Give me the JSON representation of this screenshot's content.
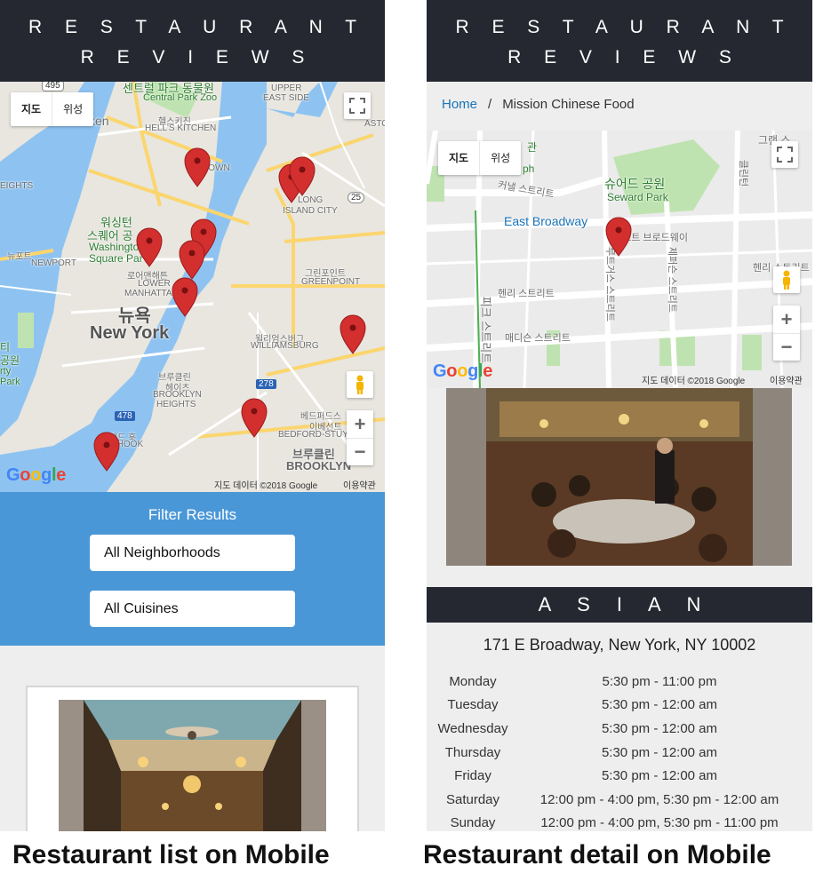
{
  "colors": {
    "header_bg": "#252831",
    "filter_bg": "#4a97d7",
    "link": "#1a73b8",
    "marker": "#d32f2f",
    "water": "#8ec3f1",
    "road": "#fbd56e"
  },
  "list_screen": {
    "header": {
      "line1": "R E S T A U R A N T",
      "line2": "R E V I E W S"
    },
    "map": {
      "map_type": {
        "map": "지도",
        "satellite": "위성"
      },
      "labels": {
        "central_park": "센트럴 파크 동물원",
        "central_park_zoo": "Central Park Zoo",
        "upper": "UPPER",
        "east_side": "EAST SIDE",
        "hells_kr": "헬스키친",
        "hells_en": "HELL'S KITCHEN",
        "ken": "ken",
        "midtown": "MIDTOWN",
        "washington_kr": "워싱턴",
        "washington_kr2": "스퀘어 공",
        "washington_en": "Washington",
        "washington_en2": "Square Par",
        "lower_kr": "로어맨해튼",
        "lower": "LOWER",
        "manhattan": "MANHATTAN",
        "newyork_kr": "뉴욕",
        "newyork_en": "New York",
        "newport_kr": "뉴포트",
        "newport_en": "NEWPORT",
        "long_island": "LONG",
        "island_city": "ISLAND CITY",
        "greenpoint_kr": "그린포인트",
        "greenpoint_en": "GREENPOINT",
        "williamsburg_kr": "윌리엄스버그",
        "williamsburg_en": "WILLIAMSBURG",
        "brooklyn_heights_kr": "브루클린",
        "brooklyn_heights_kr2": "헤이츠",
        "brooklyn_heights_en": "BROOKLYN",
        "heights": "HEIGHTS",
        "bedford_kr": "베드퍼드스",
        "bedford_kr2": "이베선트",
        "bedford_en": "BEDFORD-STUY",
        "brooklyn_kr": "브루클린",
        "brooklyn_en": "BROOKLYN",
        "red_hook_kr": "레드 훅",
        "red_hook_en": "ED HOOK",
        "heights_left": "EIGHTS",
        "route_495": "495",
        "route_25": "25",
        "route_278": "278",
        "route_478": "478",
        "astoria": "ASTO",
        "left_edge1": "티",
        "left_edge2": "공원",
        "left_edge3": "rty",
        "left_edge4": "Park"
      },
      "google": [
        "G",
        "o",
        "o",
        "g",
        "l",
        "e"
      ],
      "credit": "지도 데이터 ©2018 Google",
      "terms": "이용약관",
      "fullscreen_icon": "fullscreen-icon",
      "pegman_icon": "pegman-icon"
    },
    "filter": {
      "title": "Filter Results",
      "neighborhoods": "All Neighborhoods",
      "cuisines": "All Cuisines"
    }
  },
  "detail_screen": {
    "header": {
      "line1": "R E S T A U R A N T",
      "line2": "R E V I E W S"
    },
    "breadcrumb": {
      "home": "Home",
      "separator": "/",
      "current": "Mission Chinese Food"
    },
    "map": {
      "map_type": {
        "map": "지도",
        "satellite": "위성"
      },
      "labels": {
        "seward_kr": "슈어드 공원",
        "seward_en": "Seward Park",
        "east_broadway": "East Broadway",
        "east_broadway_kr": "이스트 브로드웨이",
        "canal": "커낼 스트리트",
        "henry": "헨리 스트리트",
        "henry_right": "헨리 스트리트",
        "madison": "매디슨 스트리트",
        "rutgers": "루트거스 스트리트",
        "jefferson": "제퍼슨 스트리트",
        "pike": "피크 스트리트",
        "clinton": "클린턴",
        "top_kr": "관",
        "top_ph": "ph",
        "top_right": "그랜 스"
      },
      "google": [
        "G",
        "o",
        "o",
        "g",
        "l",
        "e"
      ],
      "credit": "지도 데이터 ©2018 Google",
      "terms": "이용약관"
    },
    "cuisine": "A S I A N",
    "address": "171 E Broadway, New York, NY 10002",
    "hours": [
      {
        "day": "Monday",
        "time": "5:30 pm - 11:00 pm"
      },
      {
        "day": "Tuesday",
        "time": "5:30 pm - 12:00 am"
      },
      {
        "day": "Wednesday",
        "time": "5:30 pm - 12:00 am"
      },
      {
        "day": "Thursday",
        "time": "5:30 pm - 12:00 am"
      },
      {
        "day": "Friday",
        "time": "5:30 pm - 12:00 am"
      },
      {
        "day": "Saturday",
        "time": "12:00 pm - 4:00 pm, 5:30 pm - 12:00 am"
      },
      {
        "day": "Sunday",
        "time": "12:00 pm - 4:00 pm, 5:30 pm - 11:00 pm"
      }
    ]
  },
  "captions": {
    "left": "Restaurant list on Mobile",
    "right": "Restaurant detail on Mobile"
  }
}
